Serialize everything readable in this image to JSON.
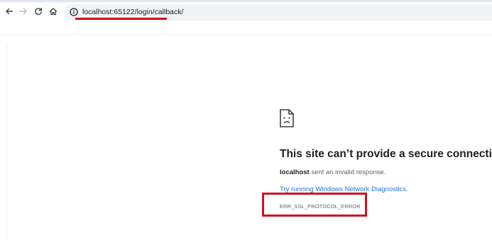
{
  "browser": {
    "url": "localhost:65122/login/callback/",
    "icons": {
      "back": "arrow-left-icon",
      "forward": "arrow-right-icon",
      "reload": "reload-icon",
      "home": "home-icon",
      "site_info": "info-circle-icon"
    }
  },
  "error_page": {
    "icon": "sad-document-icon",
    "title": "This site can’t provide a secure connection",
    "host": "localhost",
    "summary_rest": " sent an invalid response.",
    "diagnostics_link": "Try running Windows Network Diagnostics.",
    "error_code": "ERR_SSL_PROTOCOL_ERROR"
  },
  "annotations": {
    "highlight_color": "#d2101b"
  }
}
